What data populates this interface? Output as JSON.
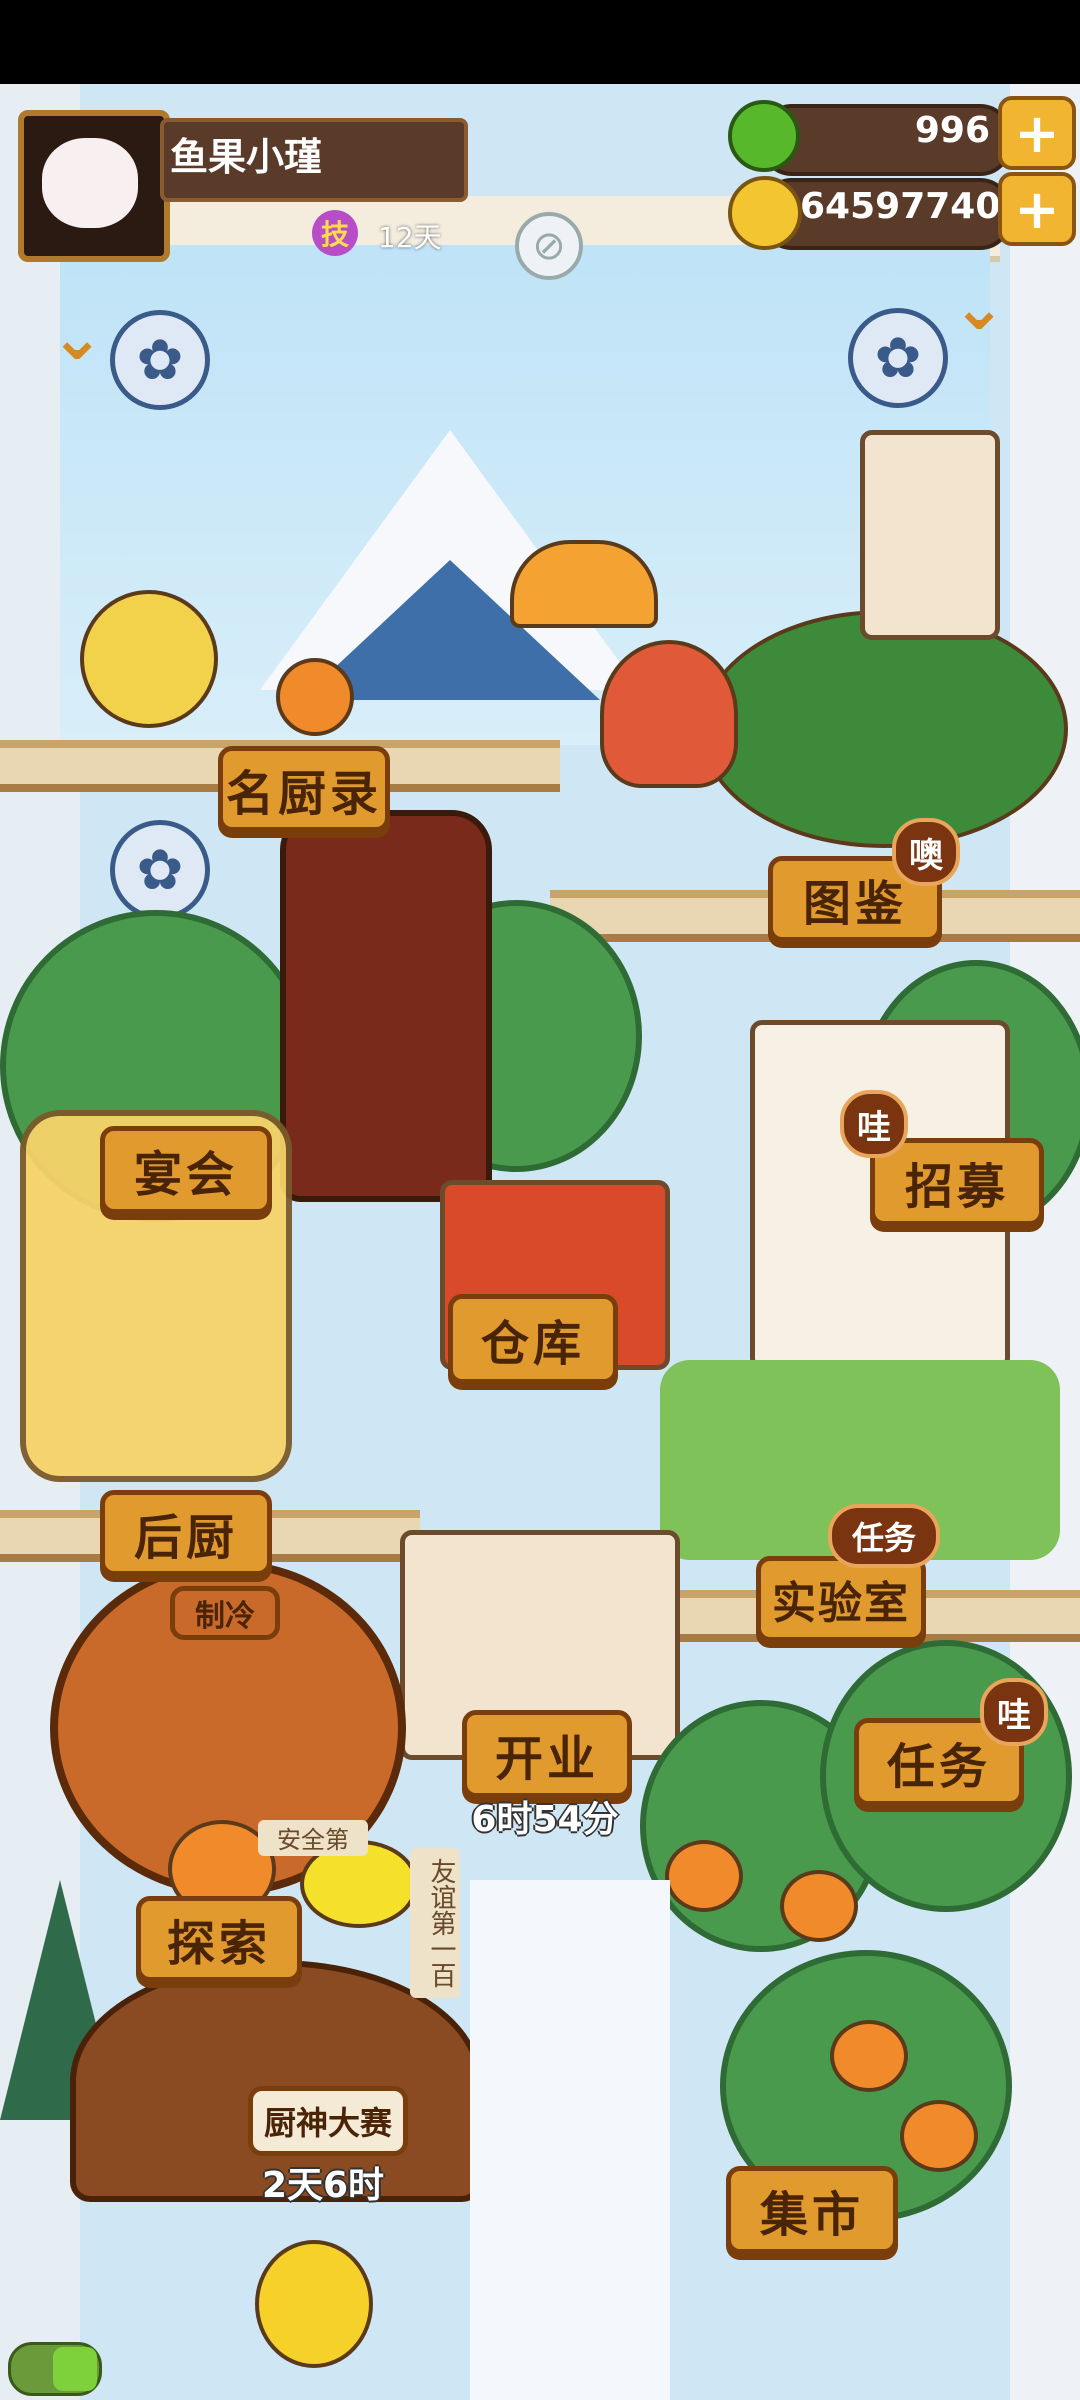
{
  "header": {
    "player_name": "鱼果小瑾",
    "skill_badge": "技",
    "skill_days": "12天"
  },
  "currencies": [
    {
      "name": "apple",
      "value": "996",
      "icon": "green-apple-icon"
    },
    {
      "name": "coins",
      "value": "64597740",
      "icon": "gold-coin-icon"
    }
  ],
  "plus_symbol": "+",
  "chevron": "⌄",
  "buildings": {
    "famous_chefs": "名厨录",
    "encyclopedia": "图鉴",
    "encyclopedia_badge": "噢",
    "banquet": "宴会",
    "recruit": "招募",
    "recruit_badge": "哇",
    "warehouse": "仓库",
    "kitchen": "后厨",
    "lab": "实验室",
    "lab_badge": "任务",
    "open_business": "开业",
    "open_business_timer": "6时54分",
    "tasks": "任务",
    "tasks_badge": "哇",
    "explore": "探索",
    "contest": "厨神大赛",
    "contest_timer": "2天6时",
    "market": "集市"
  },
  "scene_signs": {
    "cold": "制冷",
    "safe": "安全第",
    "friendship": "友谊第一百"
  },
  "colors": {
    "label_bg": "#e19a2e",
    "label_border": "#7a3e0d",
    "badge_bg": "#7a3510"
  }
}
